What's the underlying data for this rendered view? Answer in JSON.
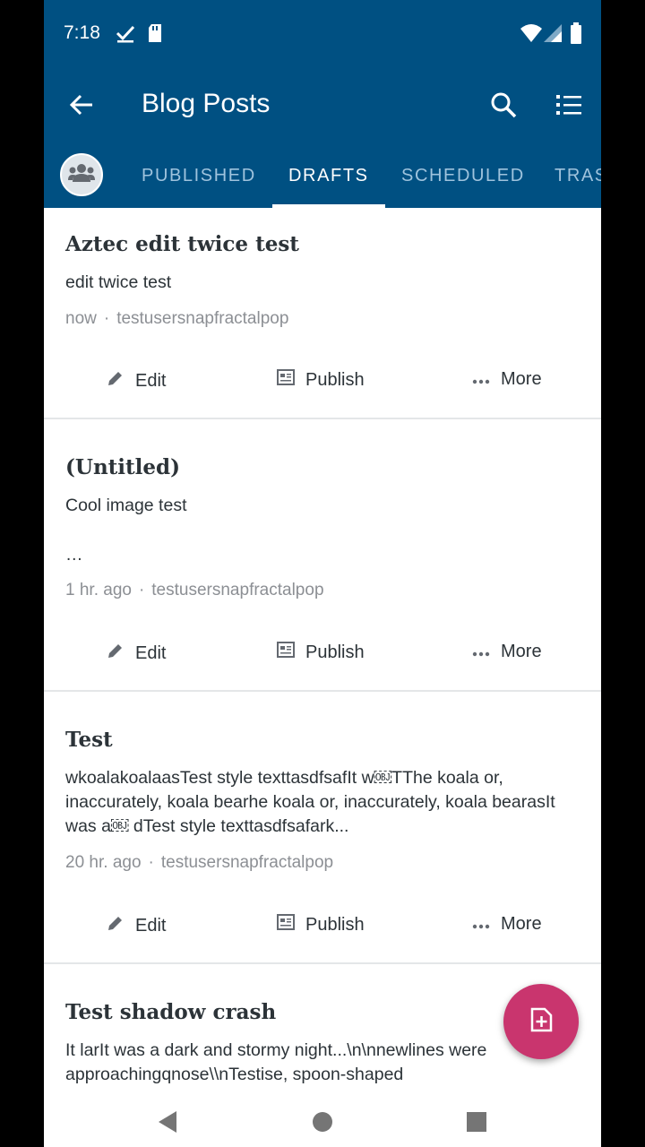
{
  "status_bar": {
    "time": "7:18"
  },
  "app_bar": {
    "title": "Blog Posts"
  },
  "tabs": [
    {
      "label": "PUBLISHED"
    },
    {
      "label": "DRAFTS"
    },
    {
      "label": "SCHEDULED"
    },
    {
      "label": "TRASHED"
    }
  ],
  "active_tab": "DRAFTS",
  "actions": {
    "edit": "Edit",
    "publish": "Publish",
    "more": "More"
  },
  "posts": [
    {
      "title": "Aztec edit twice test",
      "excerpt": "edit twice test",
      "time": "now",
      "author": "testusersnapfractalpop"
    },
    {
      "title": "(Untitled)",
      "excerpt": "Cool image test",
      "excerpt_more": "…",
      "time": "1 hr. ago",
      "author": "testusersnapfractalpop"
    },
    {
      "title": "Test",
      "excerpt": "wkoalakoalaasTest style texttasdfsafIt w￼TThe koala or, inaccurately, koala bearhe koala or, inaccurately, koala bearasIt was a￼ dTest style texttasdfsafark...",
      "time": "20 hr. ago",
      "author": "testusersnapfractalpop"
    },
    {
      "title": "Test shadow crash",
      "excerpt": "It larIt was a dark and stormy night...\\n\\nnewlines were approachingqnose\\\\nTestise, spoon-shaped"
    }
  ],
  "colors": {
    "primary": "#005082",
    "accent_fab": "#c9356e",
    "tab_inactive": "#9fc3dd"
  }
}
